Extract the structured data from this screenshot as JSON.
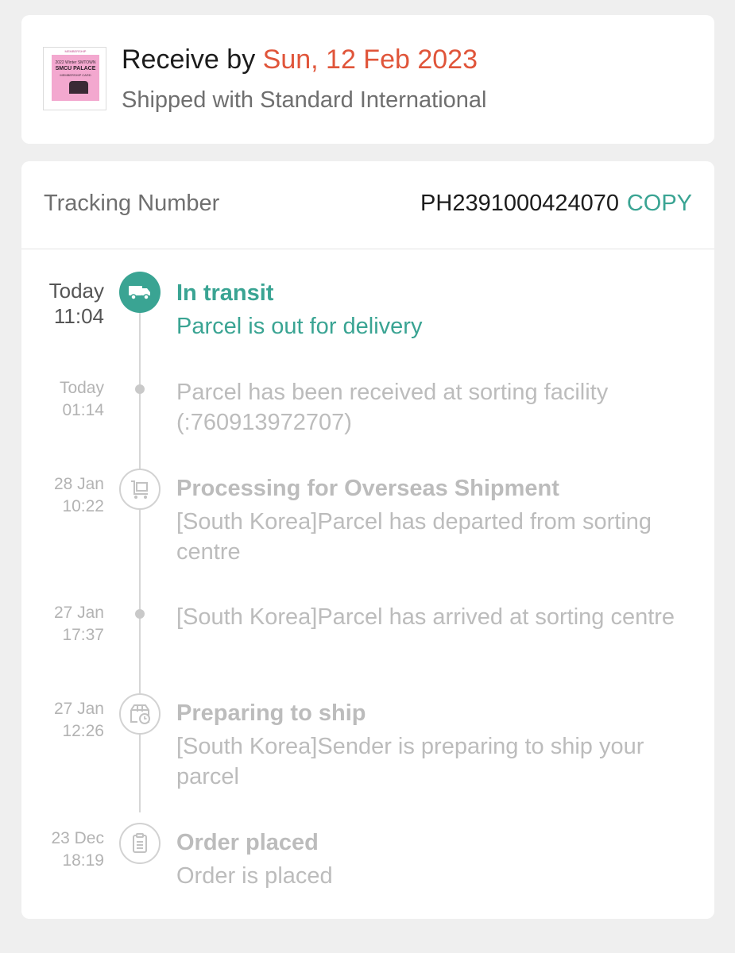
{
  "delivery": {
    "receive_prefix": "Receive by",
    "receive_date": "Sun, 12 Feb 2023",
    "shipping_method": "Shipped with Standard International",
    "thumbnail": {
      "brand": "MEMBERSHIP",
      "line1": "2022 Winter SMTOWN",
      "line2": "SMCU PALACE",
      "line3": "MEMBERSHIP CARD"
    }
  },
  "tracking": {
    "label": "Tracking Number",
    "number": "PH2391000424070",
    "copy_label": "COPY"
  },
  "events": [
    {
      "time_line1": "Today",
      "time_line2": "11:04",
      "title": "In transit",
      "description": "Parcel is out for delivery",
      "icon": "truck-icon",
      "active": true
    },
    {
      "time_line1": "Today",
      "time_line2": "01:14",
      "title": "",
      "description": "Parcel has been received at sorting facility (:760913972707)",
      "icon": "dot",
      "active": false
    },
    {
      "time_line1": "28 Jan",
      "time_line2": "10:22",
      "title": "Processing for Overseas Shipment",
      "description": "[South Korea]Parcel has departed from sorting centre",
      "icon": "cart-icon",
      "active": false
    },
    {
      "time_line1": "27 Jan",
      "time_line2": "17:37",
      "title": "",
      "description": "[South Korea]Parcel has arrived at  sorting centre",
      "icon": "dot",
      "active": false
    },
    {
      "time_line1": "27 Jan",
      "time_line2": "12:26",
      "title": "Preparing to ship",
      "description": "[South Korea]Sender is preparing to ship your parcel",
      "icon": "package-clock-icon",
      "active": false
    },
    {
      "time_line1": "23 Dec",
      "time_line2": "18:19",
      "title": "Order placed",
      "description": "Order is placed",
      "icon": "clipboard-icon",
      "active": false
    }
  ],
  "colors": {
    "accent": "#3aa493",
    "date_highlight": "#e0553a",
    "inactive": "#bcbcbc"
  }
}
